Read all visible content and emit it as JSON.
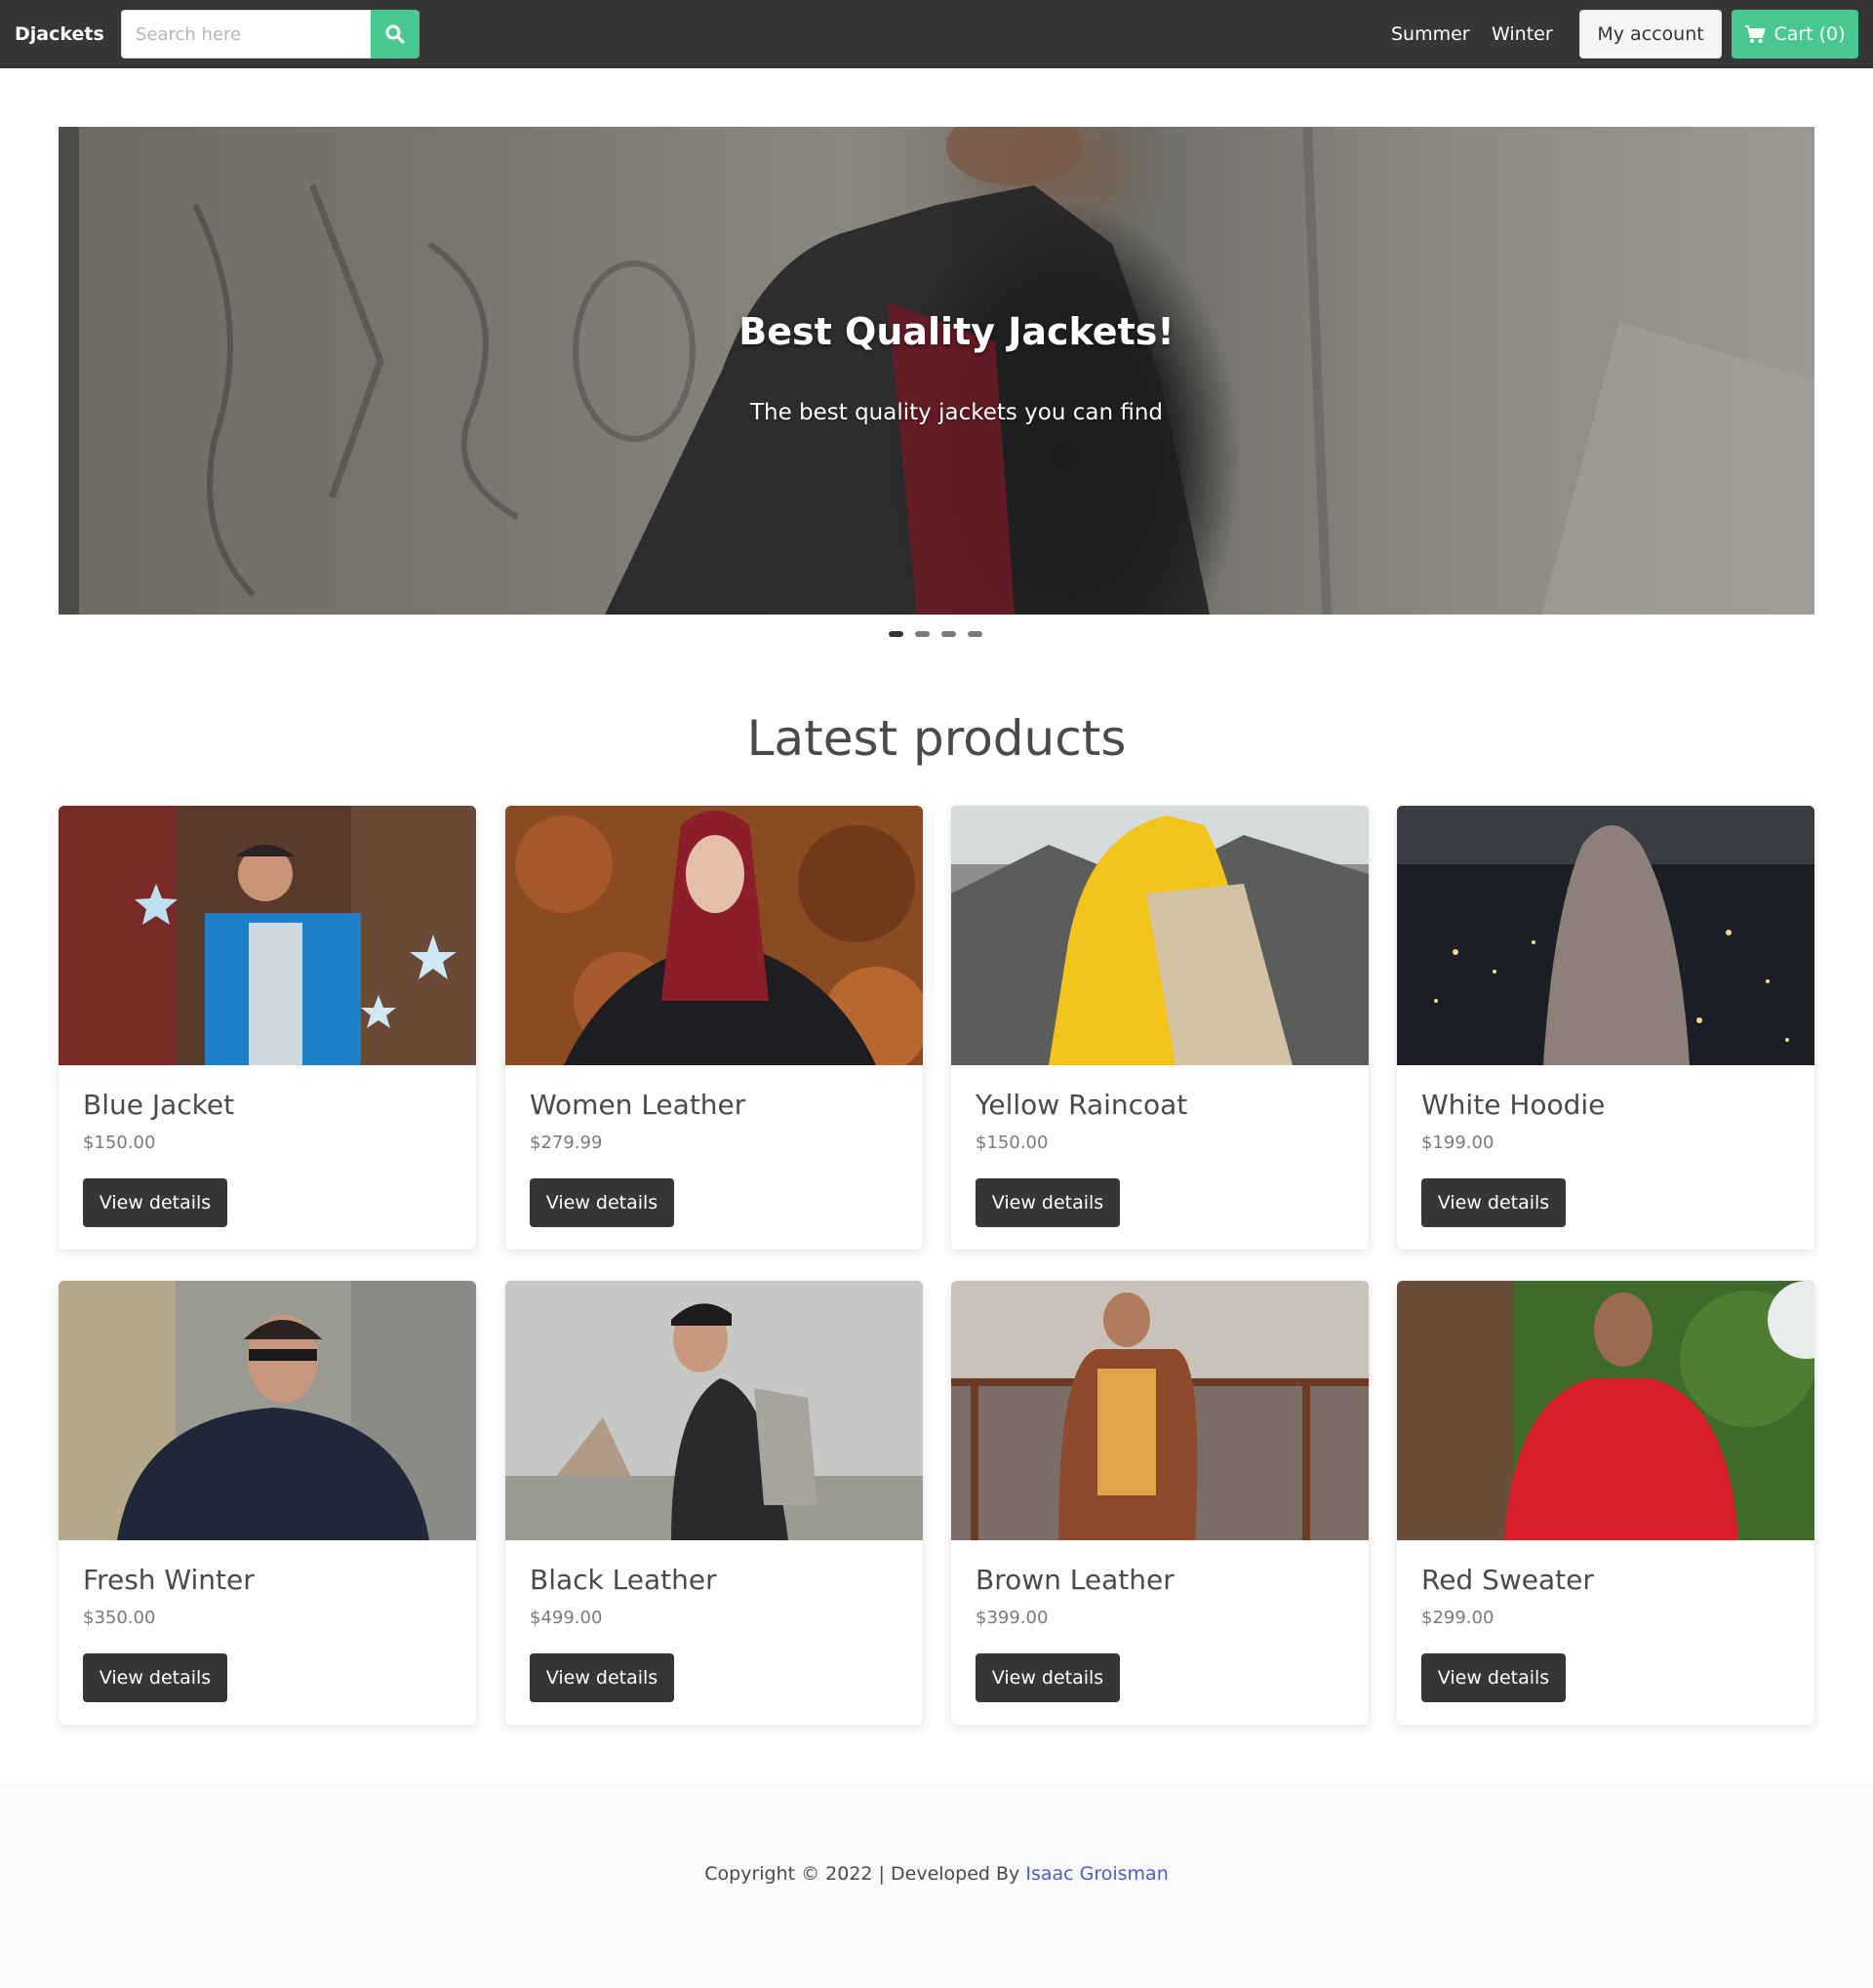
{
  "navbar": {
    "brand": "Djackets",
    "search_placeholder": "Search here",
    "links": [
      "Summer",
      "Winter"
    ],
    "account_label": "My account",
    "cart_label": "Cart (0)"
  },
  "hero": {
    "title": "Best Quality Jackets!",
    "subtitle": "The best quality jackets you can find",
    "slide_count": 4,
    "active_slide": 1
  },
  "products_section": {
    "title": "Latest products",
    "button_label": "View details",
    "products": [
      {
        "name": "Blue Jacket",
        "price": "$150.00"
      },
      {
        "name": "Women Leather",
        "price": "$279.99"
      },
      {
        "name": "Yellow Raincoat",
        "price": "$150.00"
      },
      {
        "name": "White Hoodie",
        "price": "$199.00"
      },
      {
        "name": "Fresh Winter",
        "price": "$350.00"
      },
      {
        "name": "Black Leather",
        "price": "$499.00"
      },
      {
        "name": "Brown Leather",
        "price": "$399.00"
      },
      {
        "name": "Red Sweater",
        "price": "$299.00"
      }
    ]
  },
  "footer": {
    "text": "Copyright © 2022 | Developed By",
    "author": "Isaac Groisman"
  },
  "colors": {
    "navbar_bg": "#363636",
    "accent_green": "#48c78e",
    "button_dark": "#363636",
    "link_blue": "#485fc7",
    "footer_bg": "#fafafa"
  }
}
